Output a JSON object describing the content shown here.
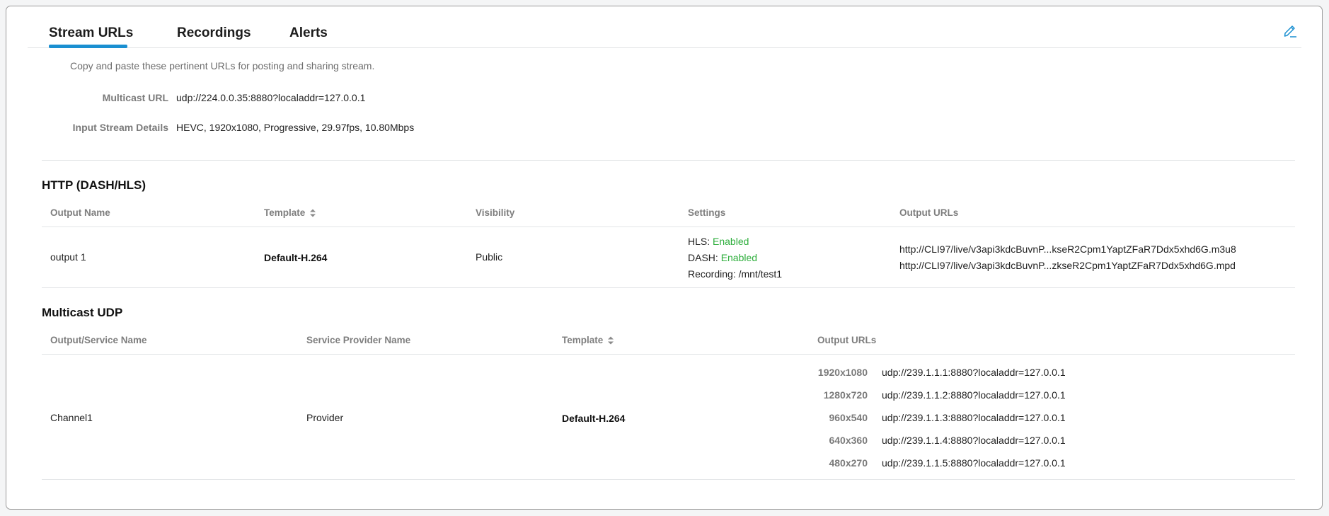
{
  "tabs": [
    {
      "label": "Stream URLs",
      "active": true
    },
    {
      "label": "Recordings",
      "active": false
    },
    {
      "label": "Alerts",
      "active": false
    }
  ],
  "subtitle": "Copy and paste these pertinent URLs for posting and sharing stream.",
  "info": {
    "multicast_url_label": "Multicast URL",
    "multicast_url_value": "udp://224.0.0.35:8880?localaddr=127.0.0.1",
    "input_stream_label": "Input Stream Details",
    "input_stream_value": "HEVC, 1920x1080, Progressive, 29.97fps, 10.80Mbps"
  },
  "http": {
    "title": "HTTP (DASH/HLS)",
    "headers": {
      "output_name": "Output Name",
      "template": "Template",
      "visibility": "Visibility",
      "settings": "Settings",
      "output_urls": "Output URLs"
    },
    "row": {
      "output_name": "output 1",
      "template": "Default-H.264",
      "visibility": "Public",
      "hls_label": "HLS:",
      "hls_value": "Enabled",
      "dash_label": "DASH:",
      "dash_value": "Enabled",
      "recording_label": "Recording:",
      "recording_value": "/mnt/test1",
      "urls": [
        "http://CLI97/live/v3api3kdcBuvnP...kseR2Cpm1YaptZFaR7Ddx5xhd6G.m3u8",
        "http://CLI97/live/v3api3kdcBuvnP...zkseR2Cpm1YaptZFaR7Ddx5xhd6G.mpd"
      ]
    }
  },
  "multicast": {
    "title": "Multicast UDP",
    "headers": {
      "service_name": "Output/Service Name",
      "provider": "Service Provider Name",
      "template": "Template",
      "output_urls": "Output URLs"
    },
    "row": {
      "service_name": "Channel1",
      "provider": "Provider",
      "template": "Default-H.264",
      "outputs": [
        {
          "res": "1920x1080",
          "url": "udp://239.1.1.1:8880?localaddr=127.0.0.1"
        },
        {
          "res": "1280x720",
          "url": "udp://239.1.1.2:8880?localaddr=127.0.0.1"
        },
        {
          "res": "960x540",
          "url": "udp://239.1.1.3:8880?localaddr=127.0.0.1"
        },
        {
          "res": "640x360",
          "url": "udp://239.1.1.4:8880?localaddr=127.0.0.1"
        },
        {
          "res": "480x270",
          "url": "udp://239.1.1.5:8880?localaddr=127.0.0.1"
        }
      ]
    }
  },
  "colors": {
    "accent": "#1a8fd1",
    "enabled": "#2eae3c"
  },
  "icons": {
    "edit": "pencil-edit-icon",
    "sort": "sort-icon"
  }
}
